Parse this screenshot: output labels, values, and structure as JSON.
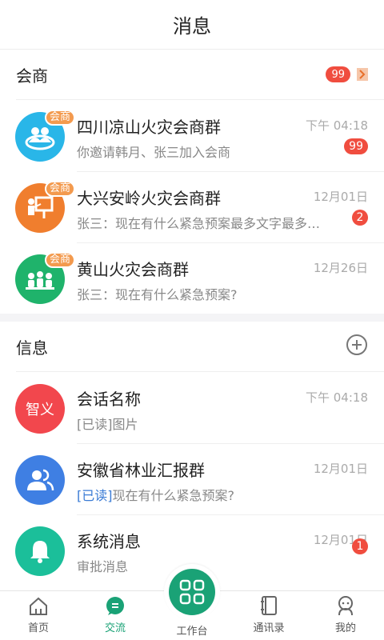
{
  "header": {
    "title": "消息"
  },
  "huishang": {
    "label": "会商",
    "badge": "99",
    "items": [
      {
        "name": "四川凉山火灾会商群",
        "sub": "你邀请韩月、张三加入会商",
        "time": "下午  04:18",
        "badge": "99",
        "tag": "会商",
        "color": "#29b6e8",
        "icon": "group-icon"
      },
      {
        "name": "大兴安岭火灾会商群",
        "sub": "张三：现在有什么紧急预案最多文字最多文字",
        "time": "12月01日",
        "badge": "2",
        "tag": "会商",
        "color": "#f07e2e",
        "icon": "presentation-icon"
      },
      {
        "name": "黄山火灾会商群",
        "sub": "张三：现在有什么紧急预案?",
        "time": "12月26日",
        "tag": "会商",
        "color": "#1fb36b",
        "icon": "meeting-icon"
      }
    ]
  },
  "xinxi": {
    "label": "信息",
    "items": [
      {
        "name": "会话名称",
        "avatar_text": "智义",
        "sub": "[已读]图片",
        "time": "下午  04:18",
        "color": "#f2474d"
      },
      {
        "name": "安徽省林业汇报群",
        "read_tag": "[已读]",
        "sub": "现在有什么紧急预案?",
        "time": "12月01日",
        "color": "#3f7fe3",
        "icon": "contacts-icon"
      },
      {
        "name": "系统消息",
        "sub": "审批消息",
        "time": "12月01日",
        "badge": "1",
        "color": "#1bbf9a",
        "icon": "bell-icon"
      }
    ]
  },
  "tabbar": {
    "home": "首页",
    "chat": "交流",
    "workbench": "工作台",
    "contacts": "通讯录",
    "mine": "我的",
    "active_color": "#1aa276"
  }
}
